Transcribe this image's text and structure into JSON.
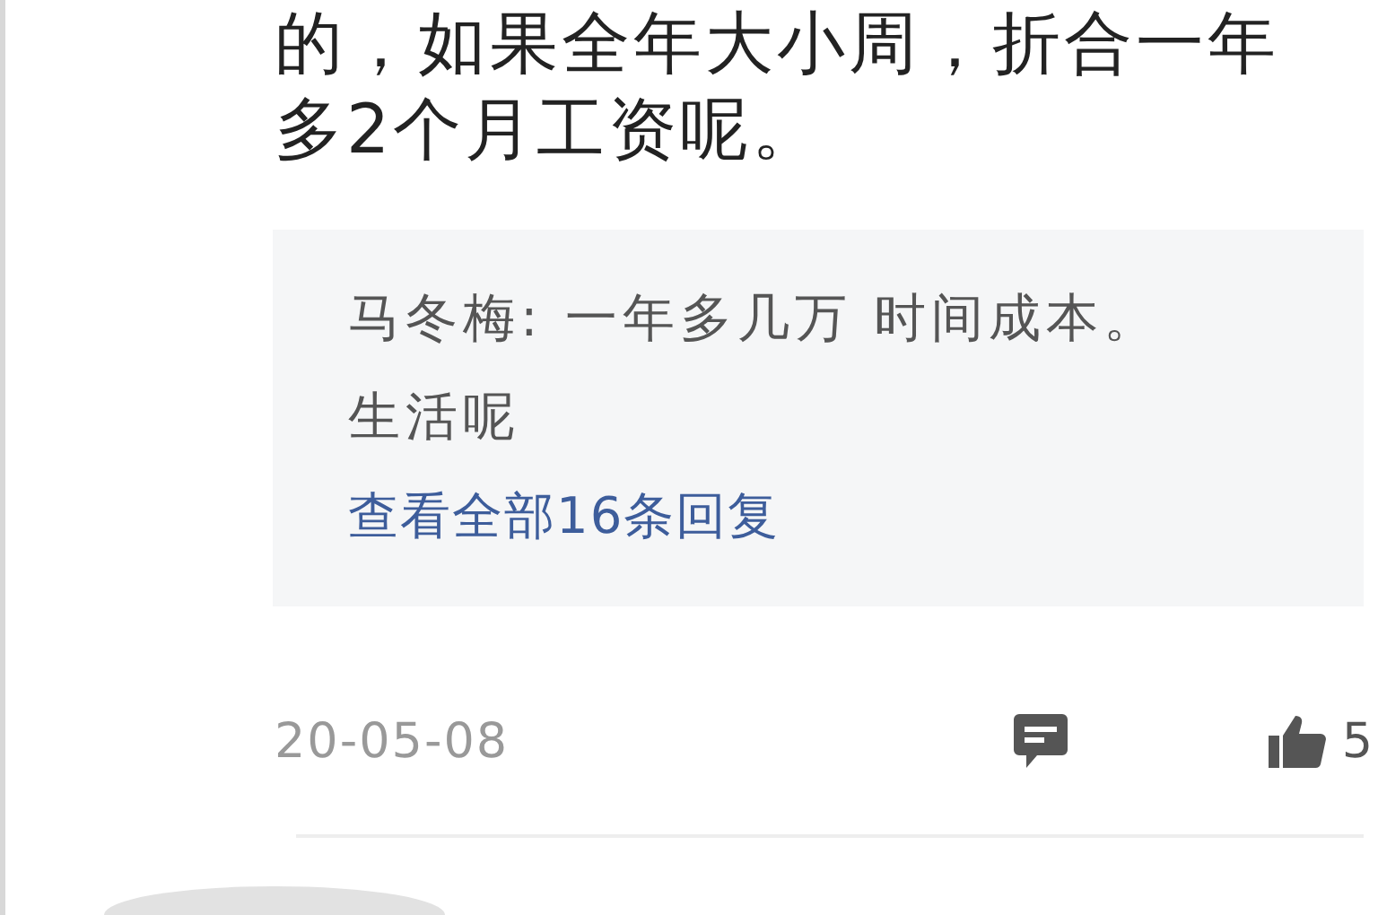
{
  "comment": {
    "text": "的，如果全年大小周，折合一年多2个月工资呢。",
    "replies": [
      {
        "text": "马冬梅: 一年多几万 时间成本。生活呢"
      }
    ],
    "view_all_link": "查看全部16条回复",
    "date": "20-05-08",
    "likes": "5"
  }
}
